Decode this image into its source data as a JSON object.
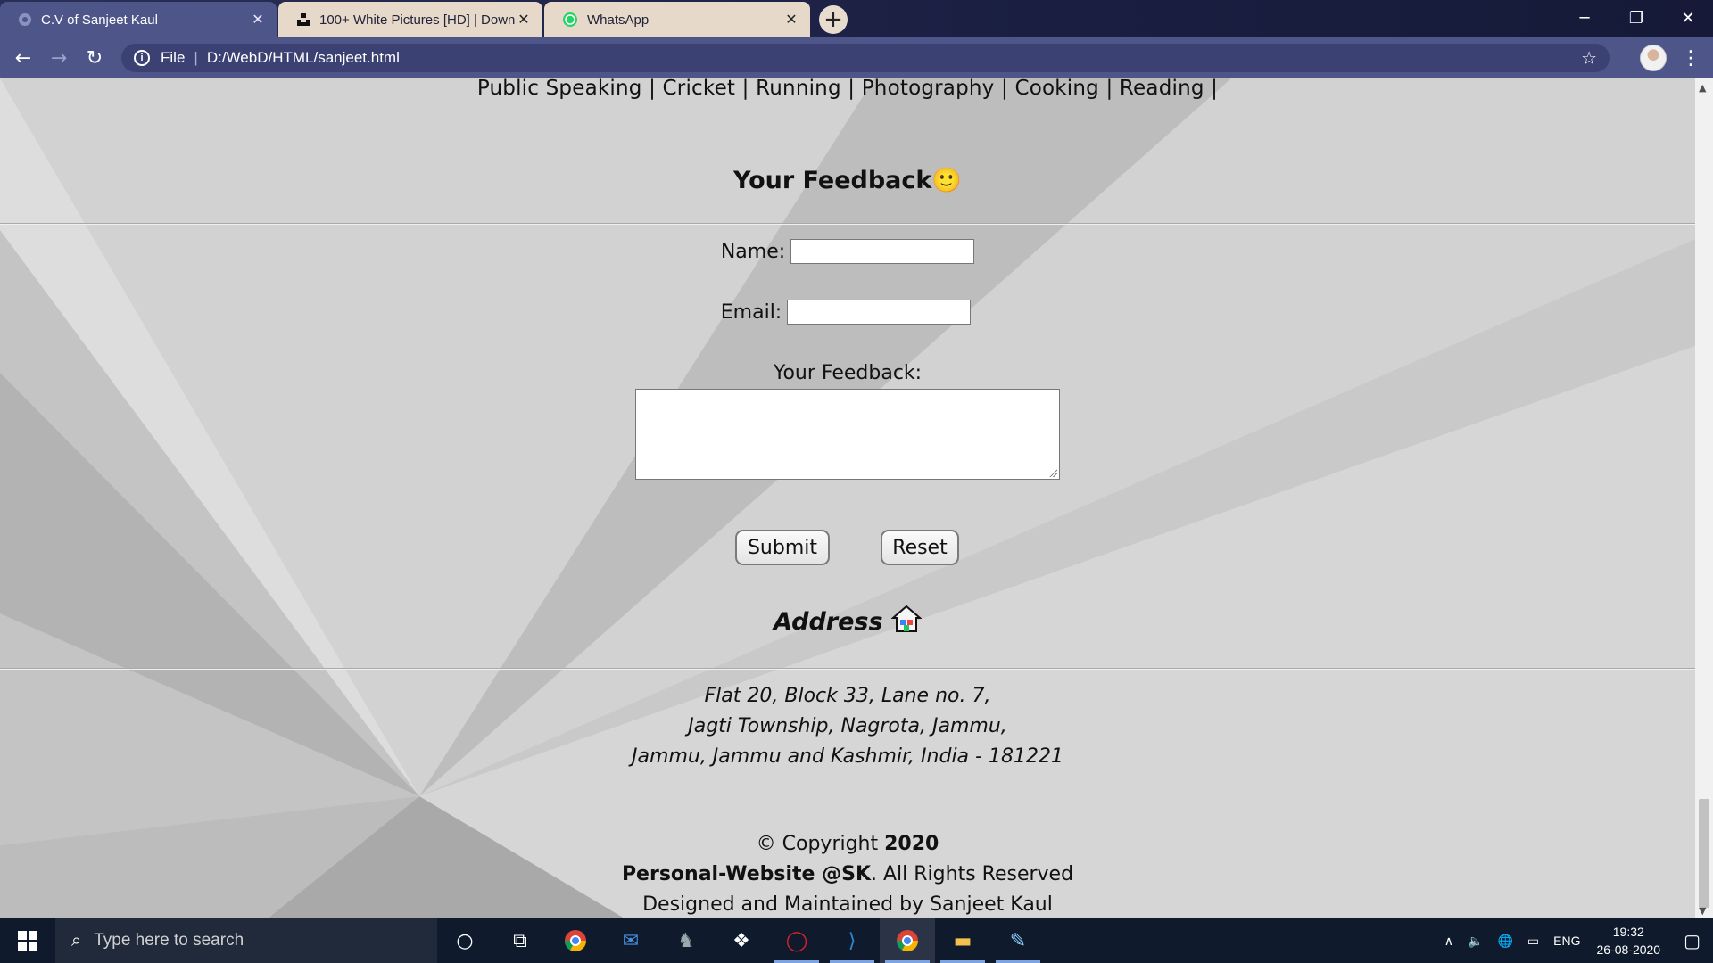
{
  "browser": {
    "tabs": [
      {
        "title": "C.V of Sanjeet Kaul",
        "active": true
      },
      {
        "title": "100+ White Pictures [HD] | Download",
        "active": false
      },
      {
        "title": "WhatsApp",
        "active": false
      }
    ],
    "new_tab_label": "+",
    "address": {
      "scheme": "File",
      "url": "D:/WebD/HTML/sanjeet.html"
    }
  },
  "page": {
    "hobbies_line": "Public Speaking | Cricket | Running | Photography | Cooking | Reading |",
    "feedback_title": "Your Feedback",
    "feedback_emoji": "🙂",
    "form": {
      "name_label": "Name:",
      "name_value": "",
      "email_label": "Email:",
      "email_value": "",
      "feedback_label": "Your Feedback:",
      "feedback_value": "",
      "submit_label": "Submit",
      "reset_label": "Reset"
    },
    "address_title": "Address",
    "address_lines": [
      "Flat 20, Block 33, Lane no. 7,",
      "Jagti Township, Nagrota, Jammu,",
      "Jammu, Jammu and Kashmir, India - 181221"
    ],
    "footer": {
      "copyright_prefix": "© Copyright ",
      "copyright_year": "2020",
      "site_name": "Personal-Website @SK",
      "rights": ". All Rights Reserved",
      "designed_by": "Designed and Maintained by Sanjeet Kaul"
    }
  },
  "taskbar": {
    "search_placeholder": "Type here to search",
    "language": "ENG",
    "time": "19:32",
    "date": "26-08-2020"
  },
  "colors": {
    "tab_active": "#4e5589",
    "toolbar": "#4e5589",
    "taskbar": "#0f1b2d",
    "page_background": "#dcdcdc"
  }
}
